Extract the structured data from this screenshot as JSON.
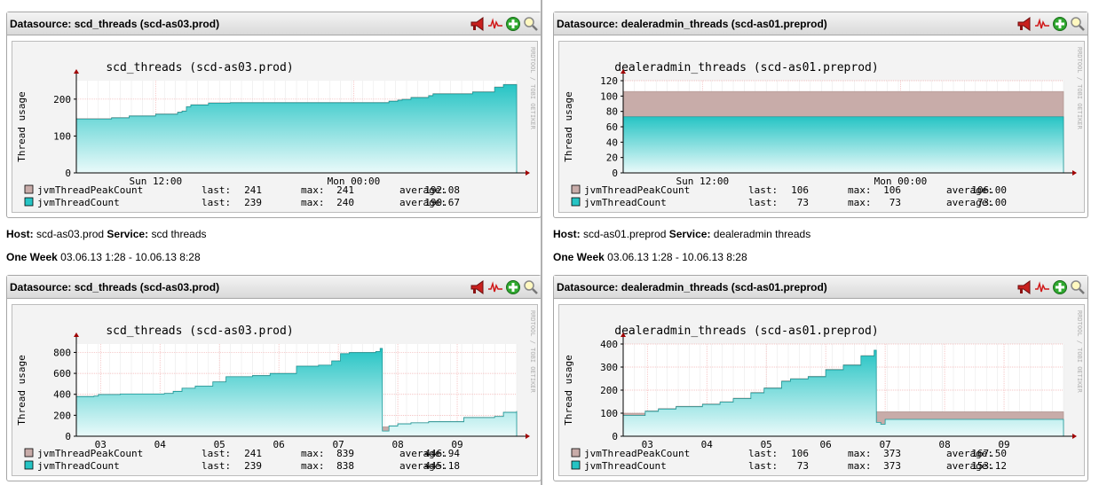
{
  "panels": [
    {
      "datasource": "Datasource: scd_threads (scd-as03.prod)",
      "chart_title": "scd_threads (scd-as03.prod)",
      "ylabel": "Thread usage",
      "watermark": "RRDTOOL / TOBI OETIKER",
      "legend": [
        {
          "name": "jvmThreadPeakCount",
          "color": "#c8aca9",
          "last": "241",
          "max": "241",
          "average": "192.08"
        },
        {
          "name": "jvmThreadCount",
          "color": "#26c4c4",
          "last": "239",
          "max": "240",
          "average": "190.67"
        }
      ]
    },
    {
      "datasource": "Datasource: dealeradmin_threads (scd-as01.preprod)",
      "chart_title": "dealeradmin_threads (scd-as01.preprod)",
      "ylabel": "Thread usage",
      "watermark": "RRDTOOL / TOBI OETIKER",
      "legend": [
        {
          "name": "jvmThreadPeakCount",
          "color": "#c8aca9",
          "last": "106",
          "max": "106",
          "average": "106.00"
        },
        {
          "name": "jvmThreadCount",
          "color": "#26c4c4",
          "last": "73",
          "max": "73",
          "average": "73.00"
        }
      ]
    },
    {
      "datasource": "Datasource: scd_threads (scd-as03.prod)",
      "chart_title": "scd_threads (scd-as03.prod)",
      "ylabel": "Thread usage",
      "watermark": "RRDTOOL / TOBI OETIKER",
      "legend": [
        {
          "name": "jvmThreadPeakCount",
          "color": "#c8aca9",
          "last": "241",
          "max": "839",
          "average": "446.94"
        },
        {
          "name": "jvmThreadCount",
          "color": "#26c4c4",
          "last": "239",
          "max": "838",
          "average": "445.18"
        }
      ]
    },
    {
      "datasource": "Datasource: dealeradmin_threads (scd-as01.preprod)",
      "chart_title": "dealeradmin_threads (scd-as01.preprod)",
      "ylabel": "Thread usage",
      "watermark": "RRDTOOL / TOBI OETIKER",
      "legend": [
        {
          "name": "jvmThreadPeakCount",
          "color": "#c8aca9",
          "last": "106",
          "max": "373",
          "average": "167.50"
        },
        {
          "name": "jvmThreadCount",
          "color": "#26c4c4",
          "last": "73",
          "max": "373",
          "average": "153.12"
        }
      ]
    }
  ],
  "info": {
    "left": {
      "host_label": "Host:",
      "host": "scd-as03.prod",
      "service_label": "Service:",
      "service": "scd threads",
      "period_label": "One Week",
      "period": "03.06.13 1:28 - 10.06.13 8:28"
    },
    "right": {
      "host_label": "Host:",
      "host": "scd-as01.preprod",
      "service_label": "Service:",
      "service": "dealeradmin threads",
      "period_label": "One Week",
      "period": "03.06.13 1:28 - 10.06.13 8:28"
    }
  },
  "tool_icons": [
    "megaphone-icon",
    "graph-wave-icon",
    "add-icon",
    "zoom-icon"
  ],
  "chart_data": [
    {
      "type": "area",
      "title": "scd_threads (scd-as03.prod)",
      "ylabel": "Thread usage",
      "ylim": [
        0,
        250
      ],
      "yticks": [
        0,
        100,
        200
      ],
      "xticks": [
        "Sun 12:00",
        "Mon 00:00"
      ],
      "xtick_positions": [
        0.18,
        0.63
      ],
      "series": [
        {
          "name": "jvmThreadPeakCount",
          "color": "#c8aca9",
          "x": [
            0,
            0.08,
            0.12,
            0.18,
            0.23,
            0.24,
            0.25,
            0.26,
            0.3,
            0.35,
            0.4,
            0.55,
            0.7,
            0.71,
            0.73,
            0.74,
            0.76,
            0.8,
            0.81,
            0.9,
            0.95,
            0.97,
            1.0
          ],
          "values": [
            147,
            150,
            155,
            160,
            165,
            168,
            180,
            185,
            190,
            191,
            191,
            191,
            191,
            195,
            198,
            200,
            205,
            210,
            215,
            220,
            233,
            240,
            241
          ]
        },
        {
          "name": "jvmThreadCount",
          "color": "#26c4c4",
          "x": [
            0,
            0.08,
            0.12,
            0.18,
            0.23,
            0.24,
            0.25,
            0.26,
            0.3,
            0.35,
            0.4,
            0.55,
            0.7,
            0.71,
            0.73,
            0.74,
            0.76,
            0.8,
            0.81,
            0.9,
            0.95,
            0.97,
            1.0
          ],
          "values": [
            146,
            149,
            154,
            159,
            164,
            167,
            179,
            184,
            189,
            190,
            190,
            190,
            190,
            194,
            197,
            199,
            204,
            209,
            214,
            219,
            232,
            239,
            239
          ]
        }
      ]
    },
    {
      "type": "area",
      "title": "dealeradmin_threads (scd-as01.preprod)",
      "ylabel": "Thread usage",
      "ylim": [
        0,
        120
      ],
      "yticks": [
        0,
        20,
        40,
        60,
        80,
        100,
        120
      ],
      "xticks": [
        "Sun 12:00",
        "Mon 00:00"
      ],
      "xtick_positions": [
        0.18,
        0.63
      ],
      "series": [
        {
          "name": "jvmThreadPeakCount",
          "color": "#c8aca9",
          "x": [
            0,
            1.0
          ],
          "values": [
            106,
            106
          ]
        },
        {
          "name": "jvmThreadCount",
          "color": "#26c4c4",
          "x": [
            0,
            1.0
          ],
          "values": [
            73,
            73
          ]
        }
      ]
    },
    {
      "type": "area",
      "title": "scd_threads (scd-as03.prod)",
      "ylabel": "Thread usage",
      "ylim": [
        0,
        880
      ],
      "yticks": [
        0,
        200,
        400,
        600,
        800
      ],
      "xticks": [
        "03",
        "04",
        "05",
        "06",
        "07",
        "08",
        "09"
      ],
      "xtick_positions": [
        0.055,
        0.19,
        0.325,
        0.46,
        0.595,
        0.73,
        0.865
      ],
      "series": [
        {
          "name": "jvmThreadPeakCount",
          "color": "#c8aca9",
          "x": [
            0,
            0.04,
            0.05,
            0.1,
            0.2,
            0.2,
            0.22,
            0.24,
            0.27,
            0.3,
            0.31,
            0.34,
            0.4,
            0.44,
            0.5,
            0.55,
            0.58,
            0.6,
            0.62,
            0.68,
            0.69,
            0.695,
            0.71,
            0.73,
            0.76,
            0.8,
            0.85,
            0.88,
            0.95,
            0.97,
            1.0
          ],
          "values": [
            380,
            385,
            400,
            405,
            405,
            410,
            430,
            460,
            480,
            480,
            520,
            570,
            580,
            600,
            670,
            680,
            720,
            790,
            800,
            810,
            839,
            90,
            100,
            120,
            130,
            140,
            140,
            180,
            190,
            230,
            241
          ]
        },
        {
          "name": "jvmThreadCount",
          "color": "#26c4c4",
          "x": [
            0,
            0.04,
            0.05,
            0.1,
            0.2,
            0.2,
            0.22,
            0.24,
            0.27,
            0.3,
            0.31,
            0.34,
            0.4,
            0.44,
            0.5,
            0.55,
            0.58,
            0.6,
            0.62,
            0.68,
            0.69,
            0.695,
            0.71,
            0.73,
            0.76,
            0.8,
            0.85,
            0.88,
            0.95,
            0.97,
            1.0
          ],
          "values": [
            378,
            383,
            398,
            403,
            403,
            408,
            428,
            458,
            478,
            478,
            518,
            568,
            578,
            598,
            668,
            678,
            718,
            788,
            798,
            808,
            838,
            50,
            98,
            118,
            128,
            138,
            138,
            178,
            188,
            228,
            239
          ]
        }
      ]
    },
    {
      "type": "area",
      "title": "dealeradmin_threads (scd-as01.preprod)",
      "ylabel": "Thread usage",
      "ylim": [
        0,
        400
      ],
      "yticks": [
        0,
        100,
        200,
        300,
        400
      ],
      "xticks": [
        "03",
        "04",
        "05",
        "06",
        "07",
        "08",
        "09"
      ],
      "xtick_positions": [
        0.055,
        0.19,
        0.325,
        0.46,
        0.595,
        0.73,
        0.865
      ],
      "series": [
        {
          "name": "jvmThreadPeakCount",
          "color": "#c8aca9",
          "x": [
            0,
            0.05,
            0.08,
            0.12,
            0.18,
            0.22,
            0.25,
            0.29,
            0.32,
            0.36,
            0.38,
            0.42,
            0.46,
            0.5,
            0.54,
            0.57,
            0.575,
            0.585,
            0.595,
            1.0
          ],
          "values": [
            100,
            110,
            120,
            130,
            140,
            150,
            165,
            190,
            210,
            240,
            250,
            260,
            290,
            310,
            350,
            373,
            106,
            106,
            106,
            106
          ]
        },
        {
          "name": "jvmThreadCount",
          "color": "#26c4c4",
          "x": [
            0,
            0.05,
            0.08,
            0.12,
            0.18,
            0.22,
            0.25,
            0.29,
            0.32,
            0.36,
            0.38,
            0.42,
            0.46,
            0.5,
            0.54,
            0.57,
            0.575,
            0.585,
            0.595,
            1.0
          ],
          "values": [
            90,
            108,
            118,
            128,
            138,
            148,
            163,
            188,
            208,
            238,
            248,
            258,
            288,
            308,
            348,
            373,
            60,
            52,
            73,
            73
          ]
        }
      ]
    }
  ]
}
